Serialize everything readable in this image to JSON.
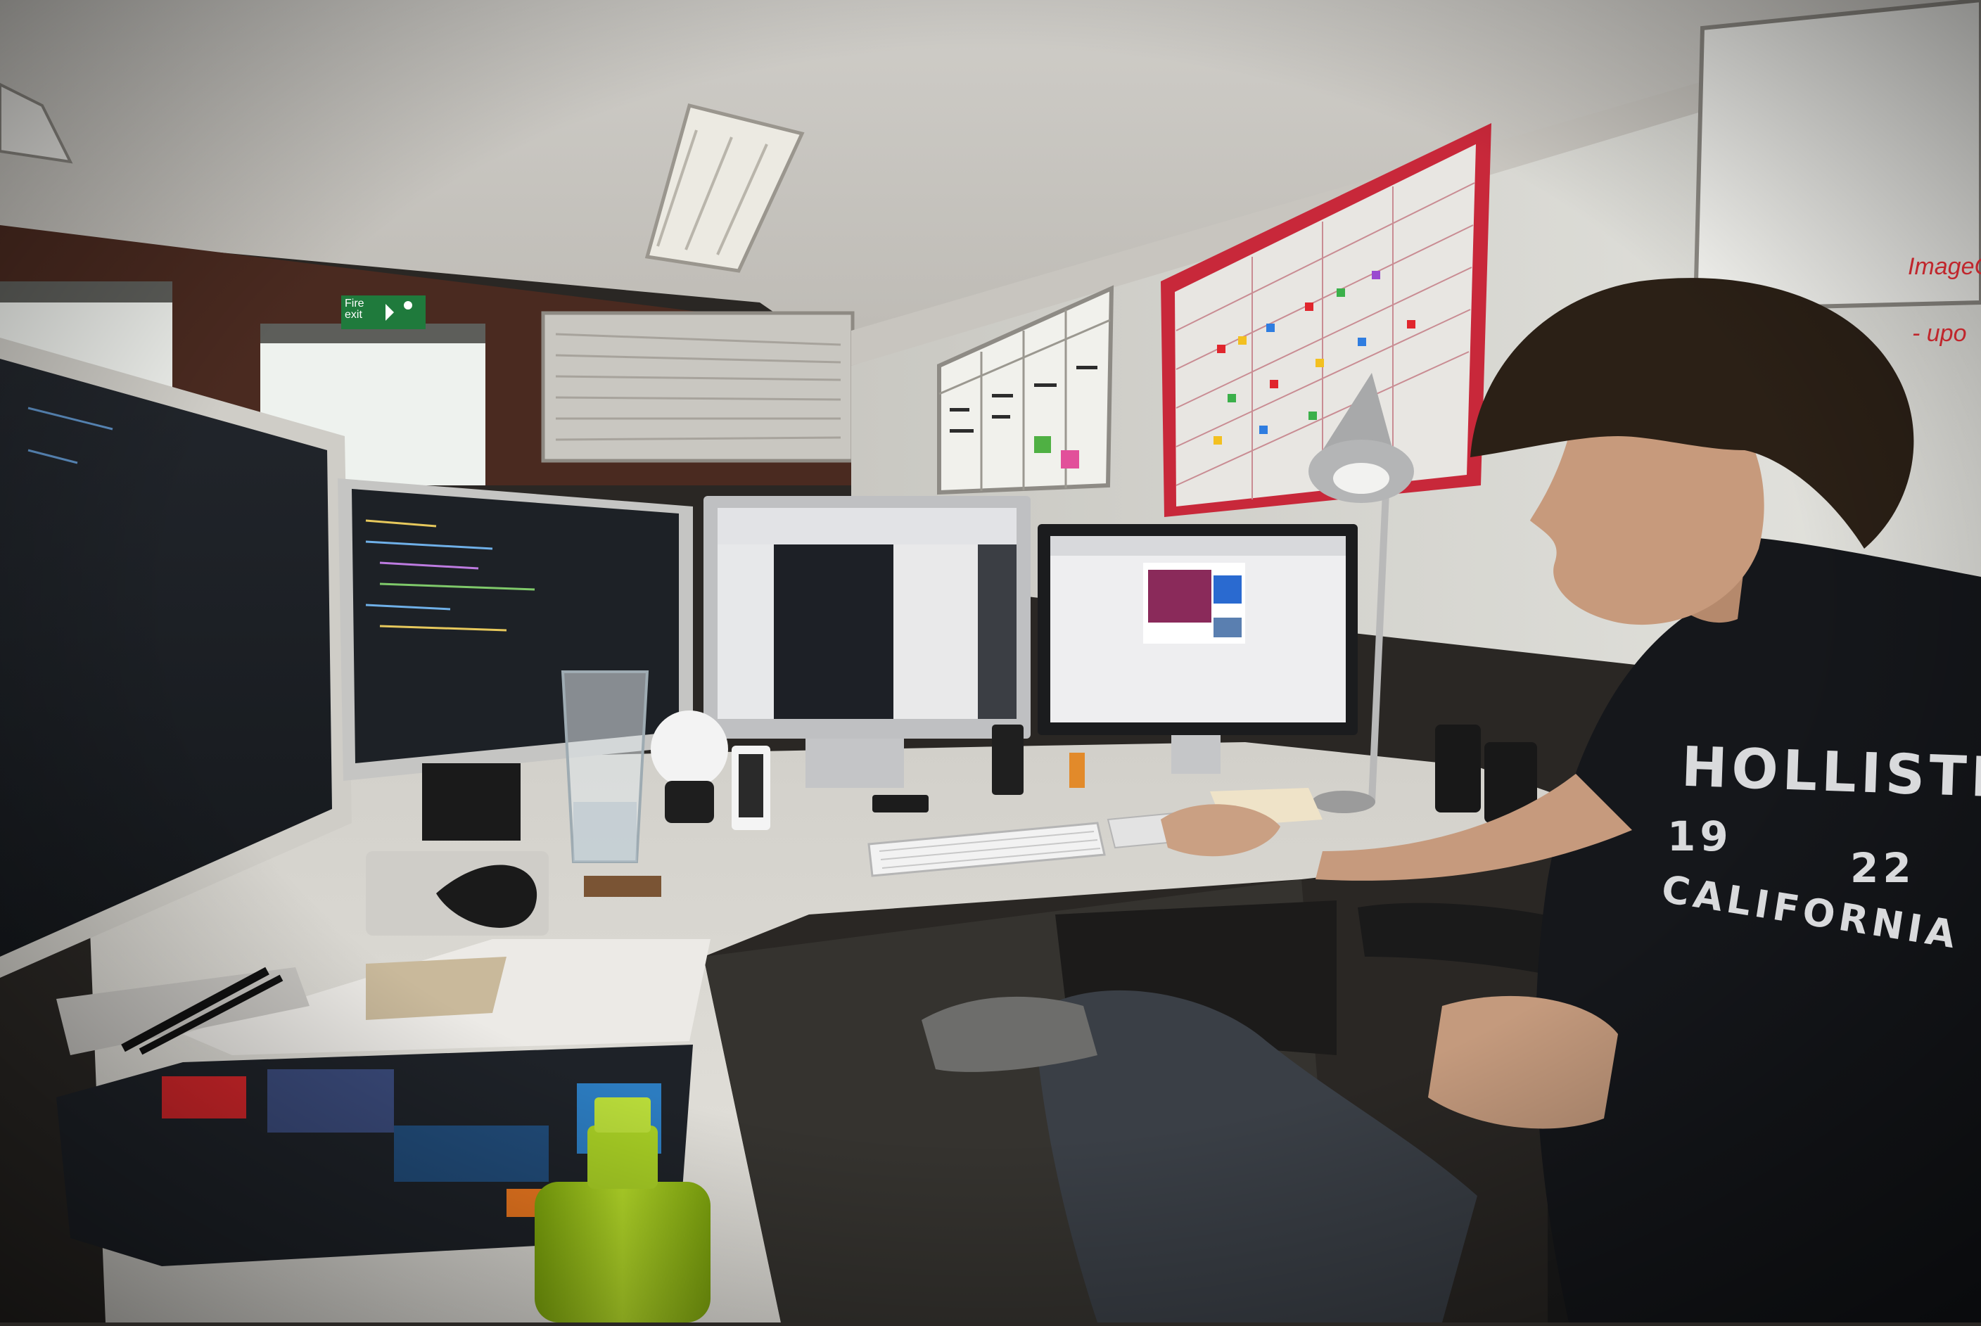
{
  "scene": {
    "description_hidden": false
  },
  "exit_sign": {
    "line1": "Fire",
    "line2": "exit"
  },
  "whiteboard_right": {
    "lines": [
      "ImageCon",
      "- upo"
    ]
  },
  "shirt": {
    "brand": "HOLLISTER",
    "year_left": "19",
    "year_right": "22",
    "place": "CALIFORNIA"
  },
  "colors": {
    "wall": "#dcdcd6",
    "ceiling": "#d8d6d0",
    "desk": "#d9d7d2",
    "screen_dark": "#1c1f24",
    "screen_light": "#eeeef0",
    "bottle_green": "#9ac418",
    "planner_red": "#c8283a",
    "shirt": "#15171b"
  }
}
